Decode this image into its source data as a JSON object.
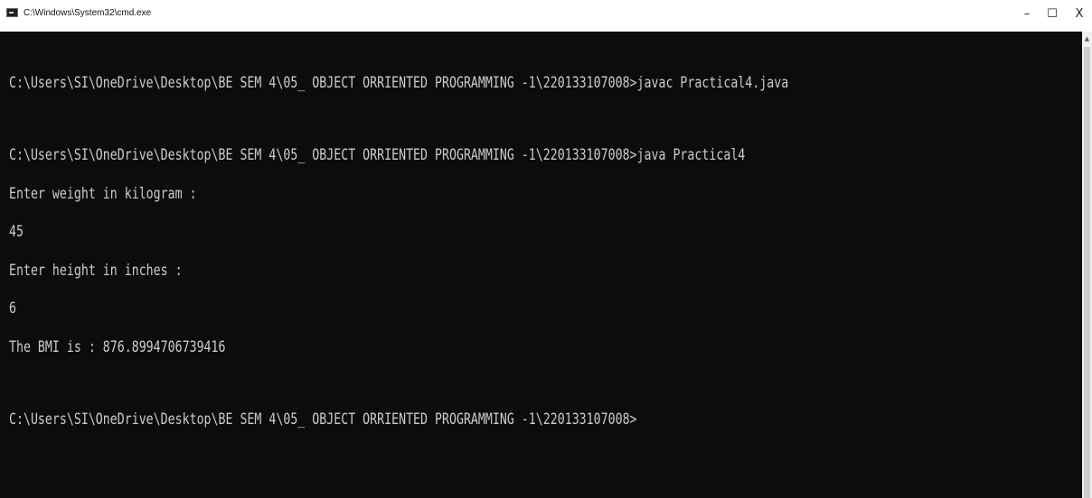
{
  "window": {
    "title": "C:\\Windows\\System32\\cmd.exe",
    "icon": "cmd-icon",
    "controls": {
      "minimize": "–",
      "maximize": "☐",
      "close": "X"
    }
  },
  "console": {
    "lines": [
      "C:\\Users\\SI\\OneDrive\\Desktop\\BE SEM 4\\05_ OBJECT ORRIENTED PROGRAMMING -1\\220133107008>javac Practical4.java",
      "C:\\Users\\SI\\OneDrive\\Desktop\\BE SEM 4\\05_ OBJECT ORRIENTED PROGRAMMING -1\\220133107008>java Practical4",
      "Enter weight in kilogram :",
      "45",
      "Enter height in inches :",
      "6",
      "The BMI is : 876.8994706739416",
      "C:\\Users\\SI\\OneDrive\\Desktop\\BE SEM 4\\05_ OBJECT ORRIENTED PROGRAMMING -1\\220133107008>"
    ],
    "text_color": "#cccccc",
    "background": "#0c0c0c"
  },
  "scrollbar": {
    "up_arrow": "▲"
  }
}
